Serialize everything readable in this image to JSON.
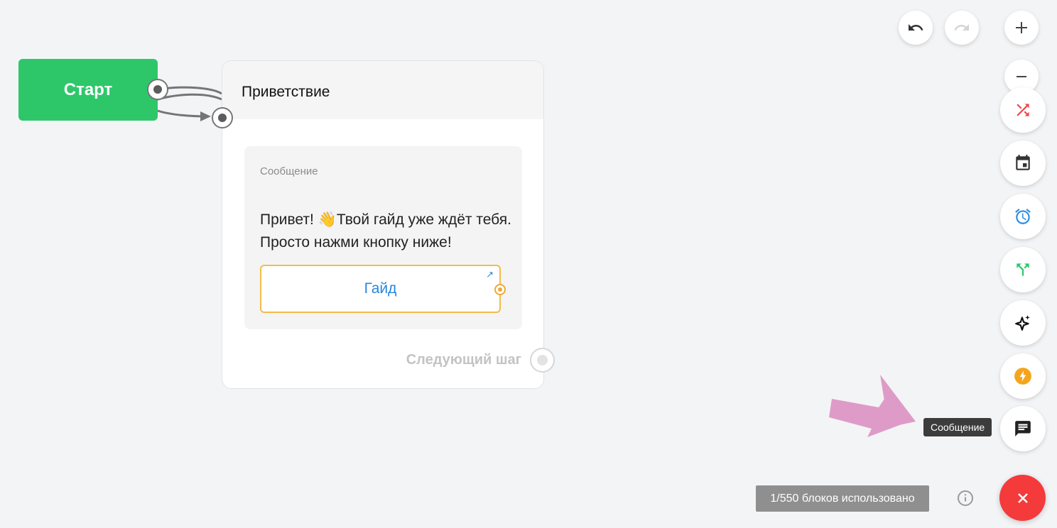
{
  "canvas": {
    "start_node": {
      "label": "Старт"
    },
    "step": {
      "title": "Приветствие",
      "message_block": {
        "label": "Сообщение",
        "text": "Привет! 👋Твой гайд уже ждёт тебя. Просто нажми кнопку ниже!",
        "button_label": "Гайд"
      },
      "next_step_label": "Следующий шаг"
    }
  },
  "toolbar": {
    "tooltip": "Сообщение",
    "icons": {
      "undo": "undo-icon",
      "redo": "redo-icon",
      "zoom_in": "plus-icon",
      "zoom_out": "minus-icon",
      "random": "shuffle-icon",
      "date": "calendar-icon",
      "timer": "alarm-clock-icon",
      "split": "fork-icon",
      "ai": "sparkle-icon",
      "action": "lightning-icon",
      "message": "chat-icon"
    },
    "colors": {
      "random": "#f04848",
      "date": "#333333",
      "timer": "#2b8ee6",
      "split": "#2dc76a",
      "action": "#f4a51c",
      "close": "#f43a3a"
    }
  },
  "footer": {
    "blocks_used": "1/550 блоков использовано"
  }
}
